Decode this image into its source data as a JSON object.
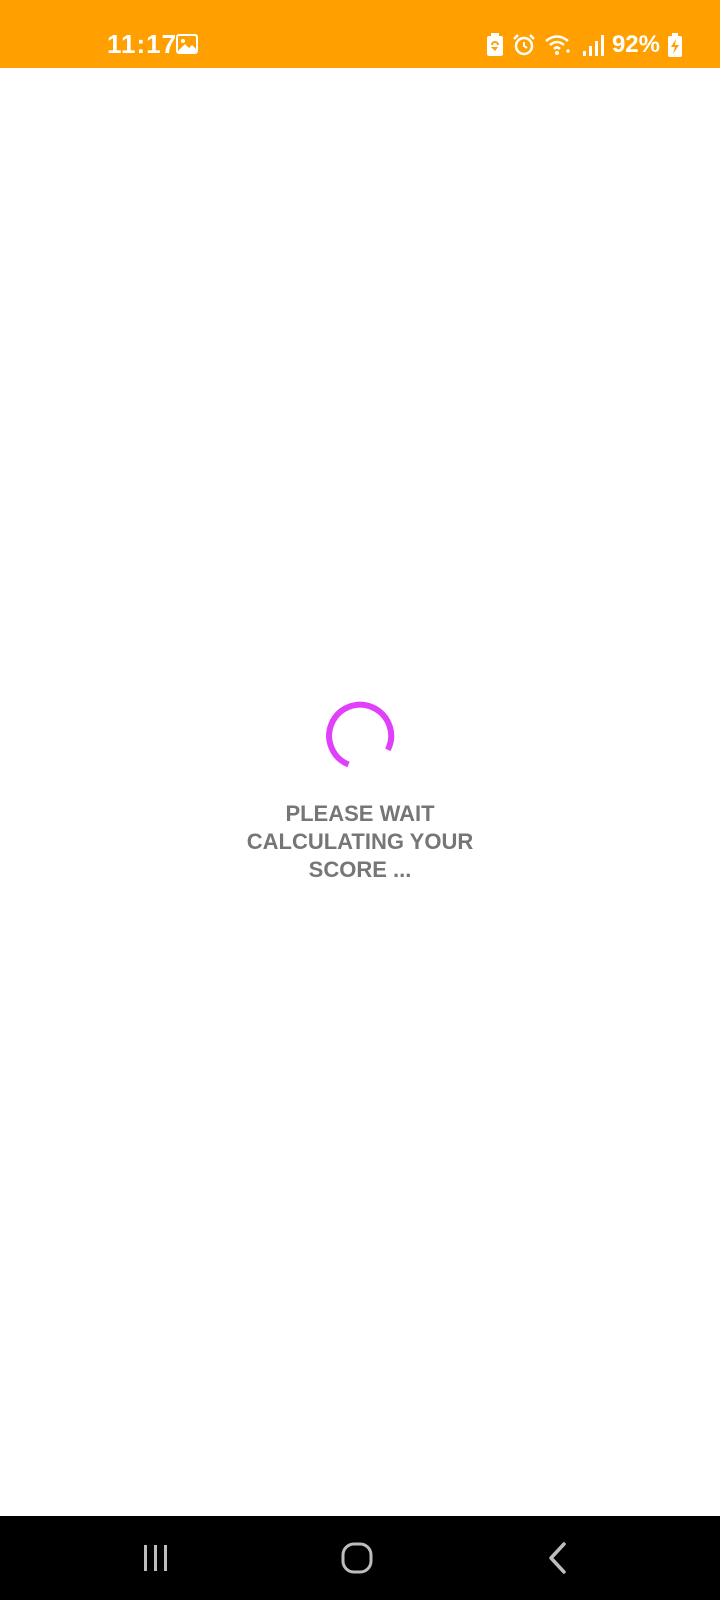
{
  "status_bar": {
    "time": "11:17",
    "battery_percent": "92%",
    "background_color": "#ffa000",
    "icons": [
      "gallery-icon",
      "battery-saver-icon",
      "alarm-icon",
      "wifi-icon",
      "signal-icon",
      "battery-charging-icon"
    ]
  },
  "loading": {
    "line1": "PLEASE WAIT",
    "line2": "CALCULATING YOUR",
    "line3": "SCORE ...",
    "spinner_color": "#e040fb",
    "text_color": "#767676"
  },
  "nav_bar": {
    "buttons": [
      "recent-apps-icon",
      "home-icon",
      "back-icon"
    ],
    "background_color": "#000000"
  }
}
